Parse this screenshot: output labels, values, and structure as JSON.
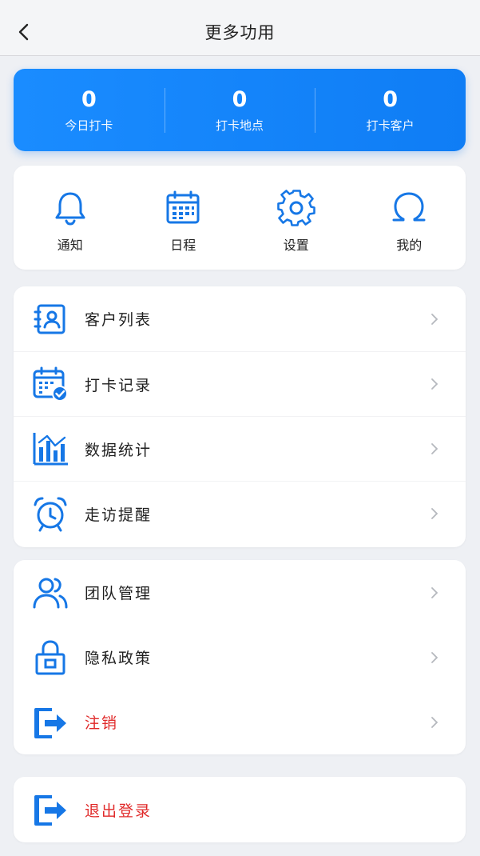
{
  "nav": {
    "title": "更多功用"
  },
  "stats": [
    {
      "value": "0",
      "label": "今日打卡"
    },
    {
      "value": "0",
      "label": "打卡地点"
    },
    {
      "value": "0",
      "label": "打卡客户"
    }
  ],
  "quick": [
    {
      "label": "通知",
      "icon": "bell-icon"
    },
    {
      "label": "日程",
      "icon": "calendar-icon"
    },
    {
      "label": "设置",
      "icon": "gear-icon"
    },
    {
      "label": "我的",
      "icon": "user-icon"
    }
  ],
  "list1": [
    {
      "label": "客户列表",
      "icon": "contacts-icon"
    },
    {
      "label": "打卡记录",
      "icon": "checkin-calendar-icon"
    },
    {
      "label": "数据统计",
      "icon": "bar-chart-icon"
    },
    {
      "label": "走访提醒",
      "icon": "alarm-clock-icon"
    }
  ],
  "list2": [
    {
      "label": "团队管理",
      "icon": "team-icon"
    },
    {
      "label": "隐私政策",
      "icon": "lock-icon"
    },
    {
      "label": "注销",
      "icon": "exit-icon"
    }
  ],
  "list3": [
    {
      "label": "退出登录",
      "icon": "logout-icon"
    }
  ],
  "colors": {
    "primary": "#1677e6",
    "danger": "#e02a2a",
    "stats_bg": "#1a8cff"
  }
}
